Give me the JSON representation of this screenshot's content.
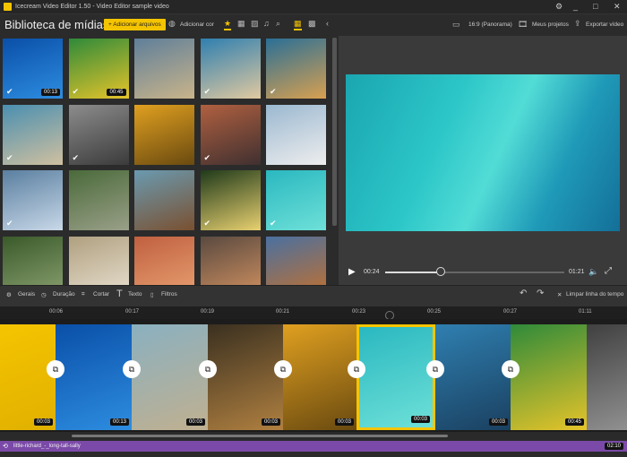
{
  "window": {
    "title": "Icecream Video Editor 1.50 - Video Editor sample video",
    "settings_icon": "gear-icon",
    "minimize": "_",
    "maximize": "□",
    "close": "✕"
  },
  "library": {
    "title": "Biblioteca de mídias",
    "add_files": "+ Adicionar arquivos",
    "add_color": "Adicionar cor",
    "filters": [
      "star-icon",
      "video-icon",
      "image-icon",
      "music-icon",
      "search-icon"
    ],
    "views": [
      "large-grid-icon",
      "small-grid-icon"
    ],
    "tiles": [
      {
        "colors": [
          "#0a4fa8",
          "#2d8de0"
        ],
        "checked": true,
        "duration": "00:13"
      },
      {
        "colors": [
          "#2f8a3a",
          "#e6c42a"
        ],
        "checked": true,
        "duration": "00:45"
      },
      {
        "colors": [
          "#5f7f9a",
          "#c9b48a"
        ],
        "checked": false
      },
      {
        "colors": [
          "#2f7fb0",
          "#e1c9a0"
        ],
        "checked": true
      },
      {
        "colors": [
          "#2a6f96",
          "#d8a050"
        ],
        "checked": true
      },
      {
        "colors": [
          "#4a8fb0",
          "#d0c0a0"
        ],
        "checked": true
      },
      {
        "colors": [
          "#8c8c8c",
          "#3b3b3b"
        ],
        "checked": true
      },
      {
        "colors": [
          "#e0a020",
          "#6a4a10"
        ],
        "checked": false
      },
      {
        "colors": [
          "#b06040",
          "#403030"
        ],
        "checked": true
      },
      {
        "colors": [
          "#9bb8d0",
          "#eeeeee"
        ],
        "checked": false
      },
      {
        "colors": [
          "#5a7fa0",
          "#c8d8e8"
        ],
        "checked": true
      },
      {
        "colors": [
          "#4a6a3a",
          "#9aa088"
        ],
        "checked": false
      },
      {
        "colors": [
          "#6a9ab0",
          "#7a5030"
        ],
        "checked": false
      },
      {
        "colors": [
          "#1f3a1a",
          "#e8d070"
        ],
        "checked": true
      },
      {
        "colors": [
          "#2ab8c0",
          "#6ee0d8"
        ],
        "checked": true
      },
      {
        "colors": [
          "#3a5a2a",
          "#8aa070"
        ],
        "checked": false
      },
      {
        "colors": [
          "#b0a080",
          "#e8e0d0"
        ],
        "checked": false
      },
      {
        "colors": [
          "#c06040",
          "#e8a070"
        ],
        "checked": false
      },
      {
        "colors": [
          "#5a4a40",
          "#d09060"
        ],
        "checked": false
      },
      {
        "colors": [
          "#4a70a0",
          "#c07030"
        ],
        "checked": false
      }
    ]
  },
  "header": {
    "aspect": "16:9 (Panorama)",
    "projects": "Meus projetos",
    "export": "Exportar vídeo"
  },
  "player": {
    "current": "00:24",
    "total": "01:21",
    "progress_percent": 31
  },
  "toolbar": {
    "general": "Gerais",
    "duration": "Duração",
    "crop": "Cortar",
    "text": "Texto",
    "filters": "Filtros",
    "clear": "Limpar linha do tempo"
  },
  "ruler": [
    "00:06",
    "00:17",
    "00:19",
    "00:21",
    "00:23",
    "00:25",
    "00:27",
    "01:11"
  ],
  "clips": [
    {
      "colors": [
        "#f5c400",
        "#e0b000"
      ],
      "duration": "00:03",
      "button": "zoom-icon"
    },
    {
      "colors": [
        "#0a4fa8",
        "#2d8de0"
      ],
      "duration": "00:13",
      "button": "transition-icon"
    },
    {
      "colors": [
        "#8ab0c0",
        "#c0b090"
      ],
      "duration": "00:03",
      "button": "transition-icon"
    },
    {
      "colors": [
        "#3a3020",
        "#b08040"
      ],
      "duration": "00:03",
      "button": "transition-icon"
    },
    {
      "colors": [
        "#e0a020",
        "#6a4a10"
      ],
      "duration": "00:03",
      "button": "transition-icon"
    },
    {
      "colors": [
        "#2ab8c0",
        "#6ee0d8"
      ],
      "duration": "00:03",
      "button": "transition-icon",
      "selected": true
    },
    {
      "colors": [
        "#2f7fb0",
        "#1a4060"
      ],
      "duration": "00:03",
      "button": "transition-icon"
    },
    {
      "colors": [
        "#2f8a3a",
        "#e6c42a"
      ],
      "duration": "00:45",
      "button": "transition-icon"
    },
    {
      "colors": [
        "#404040",
        "#909090"
      ],
      "duration": ""
    }
  ],
  "audio": {
    "name": "little-richard_-_long-tall-sally",
    "duration": "02:10"
  },
  "colors": {
    "accent": "#f5c400",
    "audio": "#7b4aa8"
  }
}
